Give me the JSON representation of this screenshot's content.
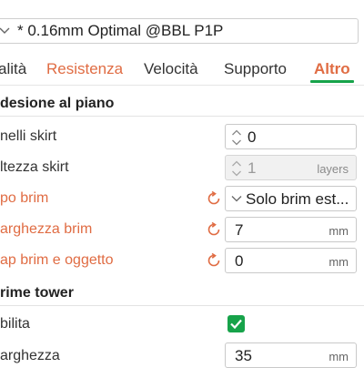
{
  "preset": {
    "name": "* 0.16mm Optimal @BBL P1P"
  },
  "tabs": [
    {
      "label": "alità"
    },
    {
      "label": "Resistenza"
    },
    {
      "label": "Velocità"
    },
    {
      "label": "Supporto"
    },
    {
      "label": "Altro"
    }
  ],
  "sections": {
    "bed_adhesion": "desione al piano",
    "prime_tower": "rime tower"
  },
  "settings": {
    "skirt_loops": {
      "label": "nelli skirt",
      "value": "0"
    },
    "skirt_height": {
      "label": "ltezza skirt",
      "value": "1",
      "unit": "layers"
    },
    "brim_type": {
      "label": "po brim",
      "value": "Solo brim est..."
    },
    "brim_width": {
      "label": "arghezza brim",
      "value": "7",
      "unit": "mm"
    },
    "brim_gap": {
      "label": "ap brim e oggetto",
      "value": "0",
      "unit": "mm"
    },
    "enable": {
      "label": "bilita"
    },
    "width": {
      "label": "arghezza",
      "value": "35",
      "unit": "mm"
    }
  },
  "colors": {
    "modified": "#e06c43",
    "accent": "#17a34a"
  },
  "icons": {
    "reset": "undo-arrow",
    "spin": "up-down-arrows",
    "dropdown": "chevron-down"
  }
}
